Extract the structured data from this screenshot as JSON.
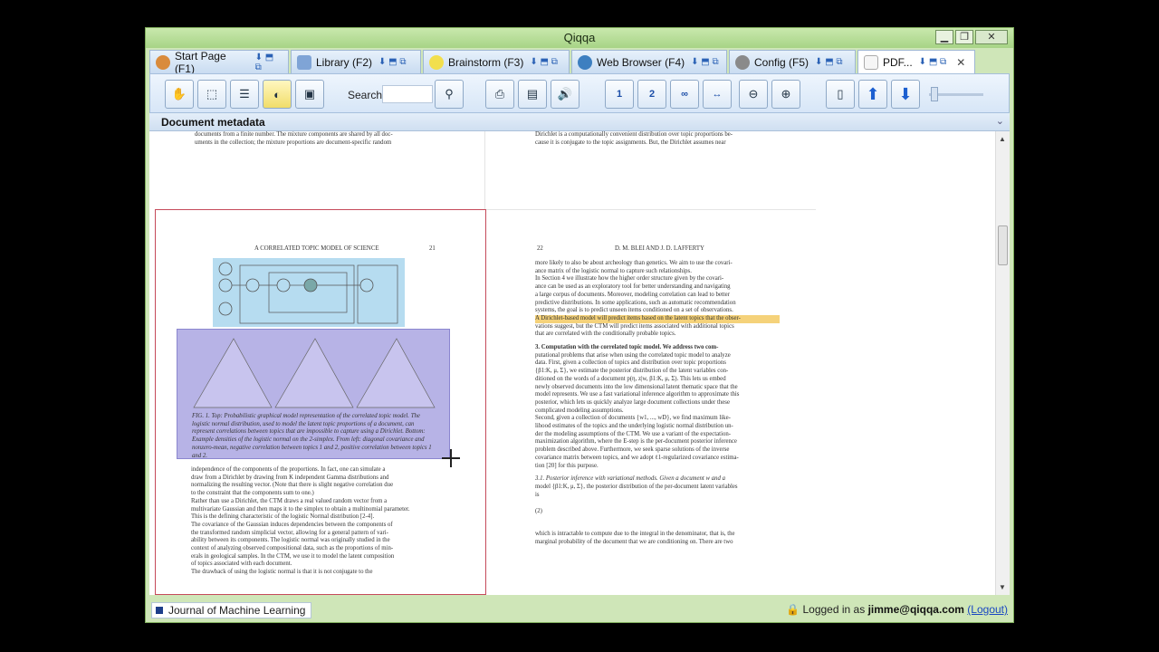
{
  "window": {
    "title": "Qiqqa",
    "controls": [
      "▁",
      "❐",
      "✕"
    ]
  },
  "tabs": [
    {
      "label": "Start Page (F1)",
      "icon": "home-icon"
    },
    {
      "label": "Library (F2)",
      "icon": "folder-icon"
    },
    {
      "label": "Brainstorm (F3)",
      "icon": "bulb-icon"
    },
    {
      "label": "Web Browser (F4)",
      "icon": "globe-icon"
    },
    {
      "label": "Config (F5)",
      "icon": "gear-icon"
    },
    {
      "label": "PDF...",
      "icon": "pdf-icon"
    }
  ],
  "toolbar": {
    "search_label": "Search:",
    "search_value": "",
    "buttons": [
      "hand-icon",
      "select-icon",
      "text-select-icon",
      "highlighter-icon",
      "snapshot-icon",
      "search-icon",
      "print-icon",
      "notes-icon",
      "speak-icon",
      "1",
      "2",
      "∞",
      "↔",
      "zoom-out-icon",
      "zoom-in-icon",
      "book-icon",
      "arrow-up-icon",
      "arrow-down-icon"
    ]
  },
  "metadata_header": "Document metadata",
  "pdf": {
    "top_left_text": [
      "documents from a finite number. The mixture components are shared by all doc-",
      "uments in the collection; the mixture proportions are document-specific random"
    ],
    "top_right_text": [
      "Dirichlet is a computationally convenient distribution over topic proportions be-",
      "cause it is conjugate to the topic assignments. But, the Dirichlet assumes near"
    ],
    "page21_header": "A CORRELATED TOPIC MODEL OF SCIENCE",
    "page21_number": "21",
    "page22_number": "22",
    "page22_header": "D. M. BLEI AND J. D. LAFFERTY",
    "caption": "FIG. 1.    Top: Probabilistic graphical model representation of the correlated topic model. The logistic normal distribution, used to model the latent topic proportions of a document, can represent correlations between topics that are impossible to capture using a Dirichlet. Bottom: Example densities of the logistic normal on the 2-simplex. From left: diagonal covariance and nonzero-mean, negative correlation between topics 1 and 2, positive correlation between topics 1 and 2.",
    "left_body": [
      "independence of the components of the proportions. In fact, one can simulate a",
      "draw from a Dirichlet by drawing from K independent Gamma distributions and",
      "normalizing the resulting vector. (Note that there is slight negative correlation due",
      "to the constraint that the components sum to one.)",
      "Rather than use a Dirichlet, the CTM draws a real valued random vector from a",
      "multivariate Gaussian and then maps it to the simplex to obtain a multinomial parameter.",
      "This is the defining characteristic of the logistic Normal distribution [2-4].",
      "The covariance of the Gaussian induces dependencies between the components of",
      "the transformed random simplicial vector, allowing for a general pattern of vari-",
      "ability between its components. The logistic normal was originally studied in the",
      "context of analyzing observed compositional data, such as the proportions of min-",
      "erals in geological samples. In the CTM, we use it to model the latent composition",
      "of topics associated with each document.",
      "The drawback of using the logistic normal is that it is not conjugate to the"
    ],
    "right_body": [
      "more likely to also be about archeology than genetics. We aim to use the covari-",
      "ance matrix of the logistic normal to capture such relationships.",
      "In Section 4 we illustrate how the higher order structure given by the covari-",
      "ance can be used as an exploratory tool for better understanding and navigating",
      "a large corpus of documents. Moreover, modeling correlation can lead to better",
      "predictive distributions. In some applications, such as automatic recommendation",
      "systems, the goal is to predict unseen items conditioned on a set of observations.",
      "A Dirichlet-based model will predict items based on the latent topics that the obser-",
      "vations suggest, but the CTM will predict items associated with additional topics",
      "that are correlated with the conditionally probable topics.",
      "3. Computation with the correlated topic model.  We address two com-",
      "putational problems that arise when using the correlated topic model to analyze",
      "data. First, given a collection of topics and distribution over topic proportions",
      "{β1:K, μ, Σ}, we estimate the posterior distribution of the latent variables con-",
      "ditioned on the words of a document p(η, z|w, β1:K, μ, Σ). This lets us embed",
      "newly observed documents into the low dimensional latent thematic space that the",
      "model represents. We use a fast variational inference algorithm to approximate this",
      "posterior, which lets us quickly analyze large document collections under these",
      "complicated modeling assumptions.",
      "Second, given a collection of documents {w1, ..., wD}, we find maximum like-",
      "lihood estimates of the topics and the underlying logistic normal distribution un-",
      "der the modeling assumptions of the CTM. We use a variant of the expectation-",
      "maximization algorithm, where the E-step is the per-document posterior inference",
      "problem described above. Furthermore, we seek sparse solutions of the inverse",
      "covariance matrix between topics, and we adopt ℓ1-regularized covariance estima-",
      "tion [20] for this purpose.",
      "3.1. Posterior inference with variational methods.  Given a document w and a",
      "model {β1:K, μ, Σ}, the posterior distribution of the per-document latent variables",
      "is",
      "which is intractable to compute due to the integral in the denominator, that is, the",
      "marginal probability of the document that we are conditioning on. There are two"
    ],
    "eq_label": "(2)"
  },
  "status": {
    "journal": "Journal of Machine Learning",
    "logged_in_prefix": "Logged in as",
    "user": "jimme@qiqqa.com",
    "logout": "(Logout)"
  }
}
